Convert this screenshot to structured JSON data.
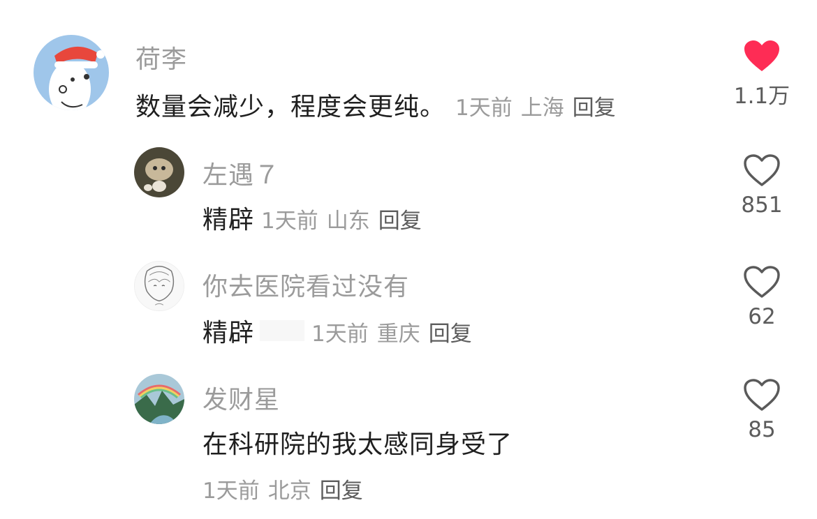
{
  "comments": [
    {
      "user": "荷李",
      "text": "数量会减少，程度会更纯。",
      "time": "1天前",
      "location": "上海",
      "reply": "回复",
      "likes": "1.1万",
      "liked": true
    },
    {
      "user": "左遇７",
      "text": "精辟",
      "time": "1天前",
      "location": "山东",
      "reply": "回复",
      "likes": "851",
      "liked": false
    },
    {
      "user": "你去医院看过没有",
      "text": "精辟",
      "time": "1天前",
      "location": "重庆",
      "reply": "回复",
      "likes": "62",
      "liked": false
    },
    {
      "user": "发财星",
      "text": "在科研院的我太感同身受了",
      "time": "1天前",
      "location": "北京",
      "reply": "回复",
      "likes": "85",
      "liked": false
    }
  ],
  "colors": {
    "liked": "#fe2c55",
    "outline": "#5a5a5a"
  }
}
